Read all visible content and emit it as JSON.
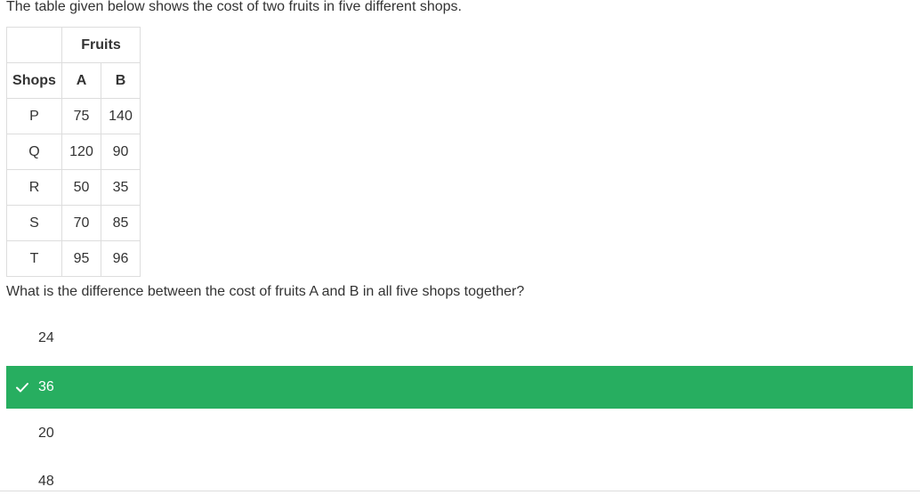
{
  "intro_text": "The table given below shows the cost of two fruits in five different shops.",
  "table": {
    "group_header": "Fruits",
    "columns": [
      "Shops",
      "A",
      "B"
    ],
    "rows": [
      [
        "P",
        "75",
        "140"
      ],
      [
        "Q",
        "120",
        "90"
      ],
      [
        "R",
        "50",
        "35"
      ],
      [
        "S",
        "70",
        "85"
      ],
      [
        "T",
        "95",
        "96"
      ]
    ]
  },
  "question": "What is the difference between the cost of fruits A and B in all five shops together?",
  "options": [
    {
      "label": "24",
      "selected": false
    },
    {
      "label": "36",
      "selected": true
    },
    {
      "label": "20",
      "selected": false
    },
    {
      "label": "48",
      "selected": false
    }
  ],
  "colors": {
    "correct_bg": "#27ae60",
    "text": "#333333",
    "border": "#dddddd"
  },
  "icons": {
    "correct": "check-icon"
  }
}
